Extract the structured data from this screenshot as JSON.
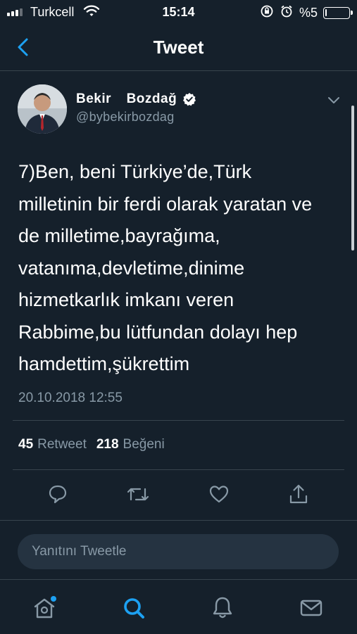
{
  "status_bar": {
    "carrier": "Turkcell",
    "time": "15:14",
    "battery_text": "%5",
    "battery_level": 0.05
  },
  "header": {
    "title": "Tweet"
  },
  "tweet": {
    "author_name": "Bekir  Bozdağ",
    "handle": "@bybekirbozdag",
    "lines": [
      "7)Ben, beni Türkiye’de,Türk",
      "milletinin bir ferdi olarak yaratan ve",
      "de milletime,bayrağıma,",
      "vatanıma,devletime,dinime",
      "hizmetkarlık imkanı veren",
      "Rabbime,bu lütfundan dolayı hep",
      "hamdettim,şükrettim"
    ],
    "timestamp": "20.10.2018 12:55",
    "retweet_count": "45",
    "retweet_label": "Retweet",
    "like_count": "218",
    "like_label": "Beğeni"
  },
  "reply": {
    "placeholder": "Yanıtını Tweetle"
  },
  "colors": {
    "background": "#15202b",
    "accent": "#1da1f2",
    "muted": "#8899a6",
    "divider": "#38444d"
  },
  "icons": {
    "back": "chevron-left-icon",
    "verified": "verified-badge-icon",
    "menu": "chevron-down-icon",
    "reply": "comment-icon",
    "retweet": "retweet-icon",
    "like": "heart-icon",
    "share": "share-icon",
    "home": "home-icon",
    "search": "search-icon",
    "notifications": "bell-icon",
    "messages": "mail-icon"
  }
}
